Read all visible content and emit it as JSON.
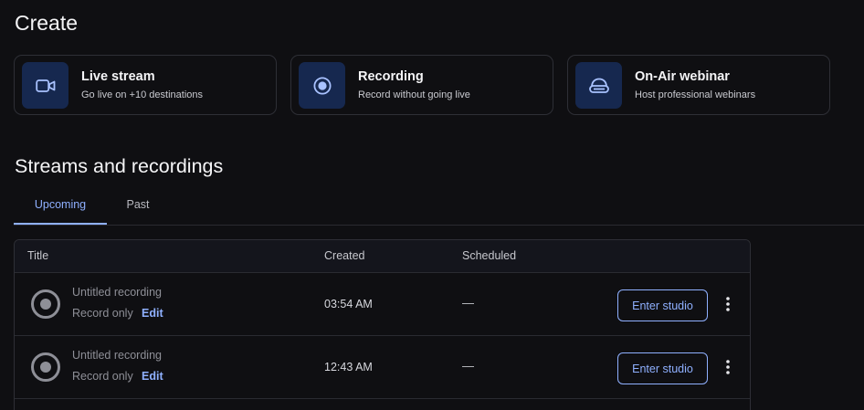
{
  "create": {
    "heading": "Create",
    "cards": [
      {
        "title": "Live stream",
        "subtitle": "Go live on +10 destinations",
        "icon": "video-camera-icon"
      },
      {
        "title": "Recording",
        "subtitle": "Record without going live",
        "icon": "record-icon"
      },
      {
        "title": "On-Air webinar",
        "subtitle": "Host professional webinars",
        "icon": "webinar-headset-icon"
      }
    ]
  },
  "streams": {
    "heading": "Streams and recordings",
    "tabs": [
      {
        "label": "Upcoming",
        "active": true
      },
      {
        "label": "Past",
        "active": false
      }
    ],
    "columns": {
      "title": "Title",
      "created": "Created",
      "scheduled": "Scheduled"
    },
    "rows": [
      {
        "title": "Untitled recording",
        "type": "Record only",
        "edit": "Edit",
        "created": "03:54 AM",
        "scheduled": "—",
        "action": "Enter studio"
      },
      {
        "title": "Untitled recording",
        "type": "Record only",
        "edit": "Edit",
        "created": "12:43 AM",
        "scheduled": "—",
        "action": "Enter studio"
      }
    ]
  },
  "colors": {
    "background": "#0f0f12",
    "accent": "#8fb0ff",
    "icon_tile": "#16284f",
    "border": "#2e2f36"
  }
}
